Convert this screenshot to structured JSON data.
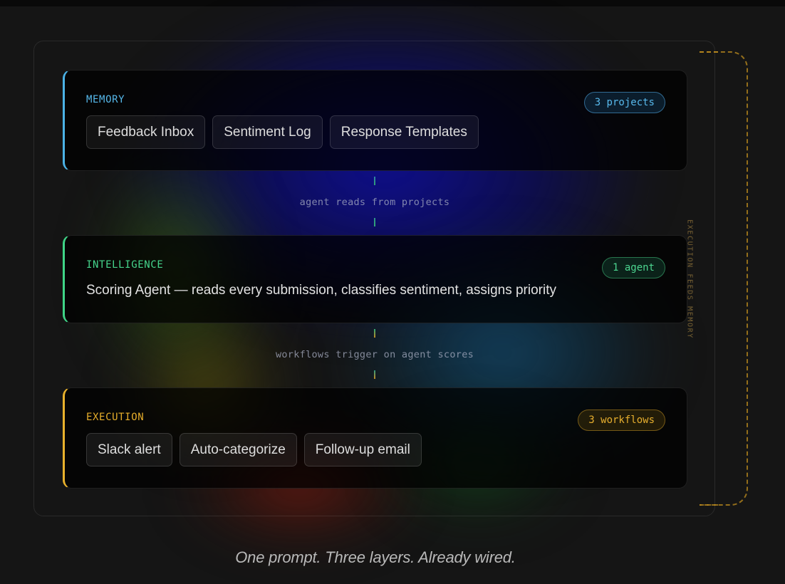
{
  "layers": {
    "memory": {
      "title": "MEMORY",
      "badge": "3 projects",
      "chips": [
        "Feedback Inbox",
        "Sentiment Log",
        "Response Templates"
      ]
    },
    "intelligence": {
      "title": "INTELLIGENCE",
      "badge": "1 agent",
      "description": "Scoring Agent — reads every submission, classifies sentiment, assigns priority"
    },
    "execution": {
      "title": "EXECUTION",
      "badge": "3 workflows",
      "chips": [
        "Slack alert",
        "Auto-categorize",
        "Follow-up email"
      ]
    }
  },
  "connectors": {
    "memory_to_intelligence": "agent reads from projects",
    "intelligence_to_execution": "workflows trigger on agent scores"
  },
  "loop": {
    "label": "EXECUTION FEEDS MEMORY"
  },
  "caption": "One prompt. Three layers. Already wired.",
  "colors": {
    "memory_accent": "#4bb2e6",
    "intelligence_accent": "#3fd487",
    "execution_accent": "#e8b12c",
    "loop_accent": "#be8c1e"
  }
}
